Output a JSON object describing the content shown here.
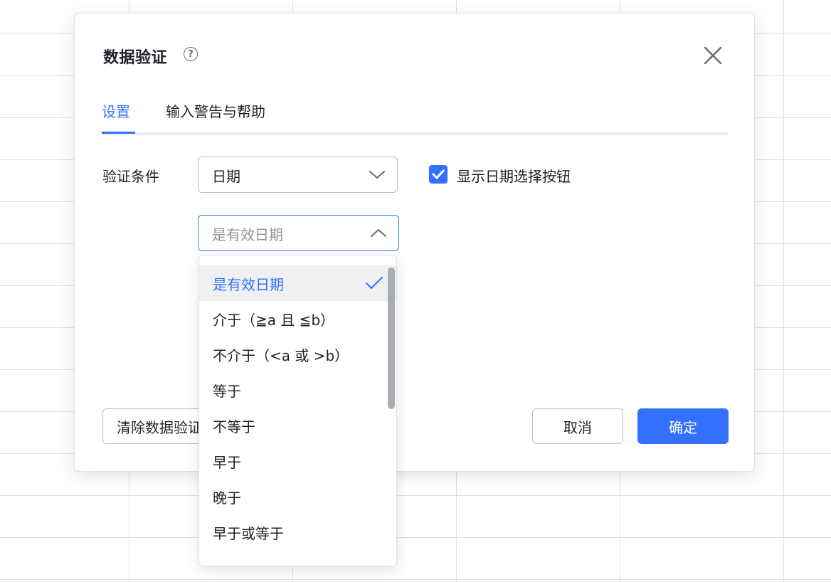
{
  "dialog": {
    "title": "数据验证",
    "help_icon": "question-circle-icon",
    "close_icon": "close-icon"
  },
  "tabs": [
    {
      "label": "设置",
      "active": true
    },
    {
      "label": "输入警告与帮助",
      "active": false
    }
  ],
  "settings": {
    "condition_label": "验证条件",
    "condition_value": "日期",
    "operator_value": "是有效日期",
    "checkbox": {
      "label": "显示日期选择按钮",
      "checked": true
    }
  },
  "dropdown": {
    "options": [
      {
        "label": "是有效日期",
        "selected": true
      },
      {
        "label": "介于（≧a 且 ≦b）",
        "selected": false
      },
      {
        "label": "不介于（<a 或 >b）",
        "selected": false
      },
      {
        "label": "等于",
        "selected": false
      },
      {
        "label": "不等于",
        "selected": false
      },
      {
        "label": "早于",
        "selected": false
      },
      {
        "label": "晚于",
        "selected": false
      },
      {
        "label": "早于或等于",
        "selected": false
      }
    ]
  },
  "footer": {
    "clear_label": "清除数据验证",
    "cancel_label": "取消",
    "confirm_label": "确定"
  },
  "colors": {
    "accent": "#3370ff",
    "text": "#1f2329",
    "placeholder": "#8f959e",
    "border": "#bbbfc4"
  }
}
